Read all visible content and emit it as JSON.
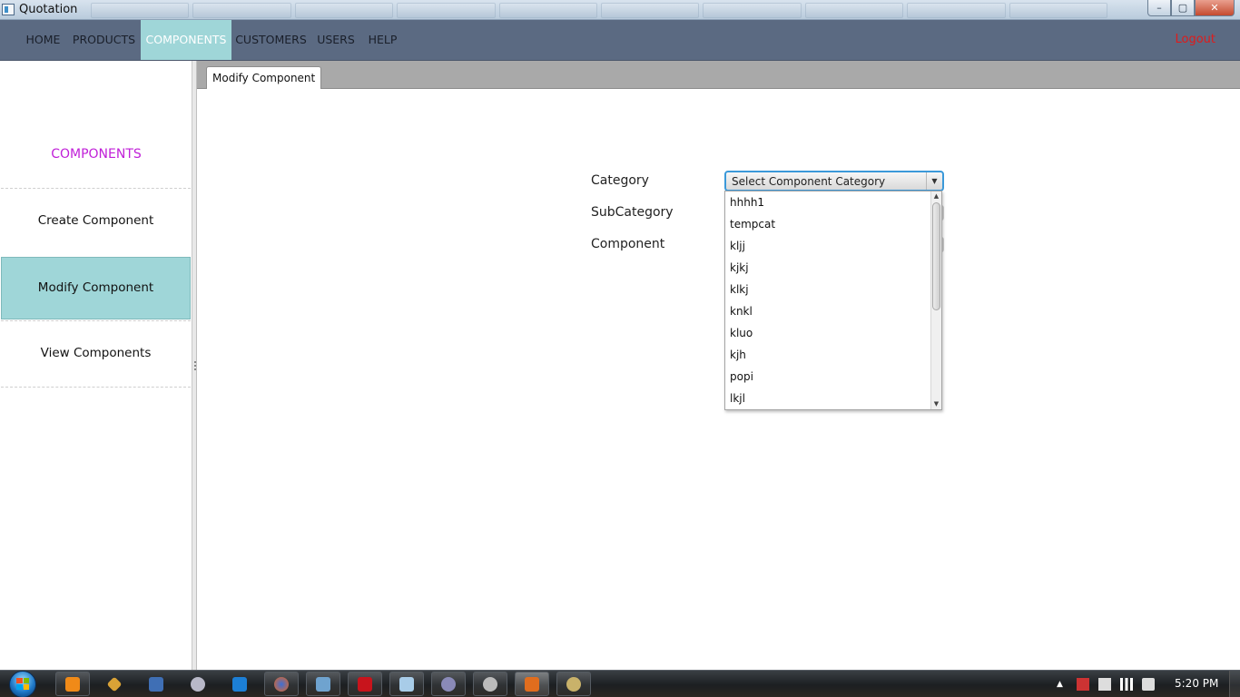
{
  "window": {
    "title": "Quotation",
    "controls": {
      "minimize": "–",
      "maximize": "▢",
      "close": "✕"
    }
  },
  "nav": {
    "items": [
      {
        "label": "HOME"
      },
      {
        "label": "PRODUCTS"
      },
      {
        "label": "COMPONENTS",
        "active": true
      },
      {
        "label": "CUSTOMERS"
      },
      {
        "label": "USERS"
      },
      {
        "label": "HELP"
      }
    ],
    "logout": "Logout"
  },
  "sidebar": {
    "heading": "COMPONENTS",
    "items": [
      {
        "label": "Create Component"
      },
      {
        "label": "Modify Component",
        "active": true
      },
      {
        "label": "View Components"
      }
    ]
  },
  "tab": {
    "label": "Modify Component"
  },
  "form": {
    "category_label": "Category",
    "subcategory_label": "SubCategory",
    "component_label": "Component",
    "category_select": "Select Component Category"
  },
  "dropdown": {
    "options": [
      "hhhh1",
      "tempcat",
      "kljj",
      "kjkj",
      "klkj",
      "knkl",
      "kluo",
      "kjh",
      "popi",
      "lkjl"
    ]
  },
  "taskbar": {
    "clock": "5:20 PM"
  },
  "colors": {
    "nav_bg": "#5b6a82",
    "accent_teal": "#9fd6d8",
    "sidebar_heading": "#c020d8",
    "logout": "#e01b1b",
    "focus_blue": "#3b99d9"
  }
}
